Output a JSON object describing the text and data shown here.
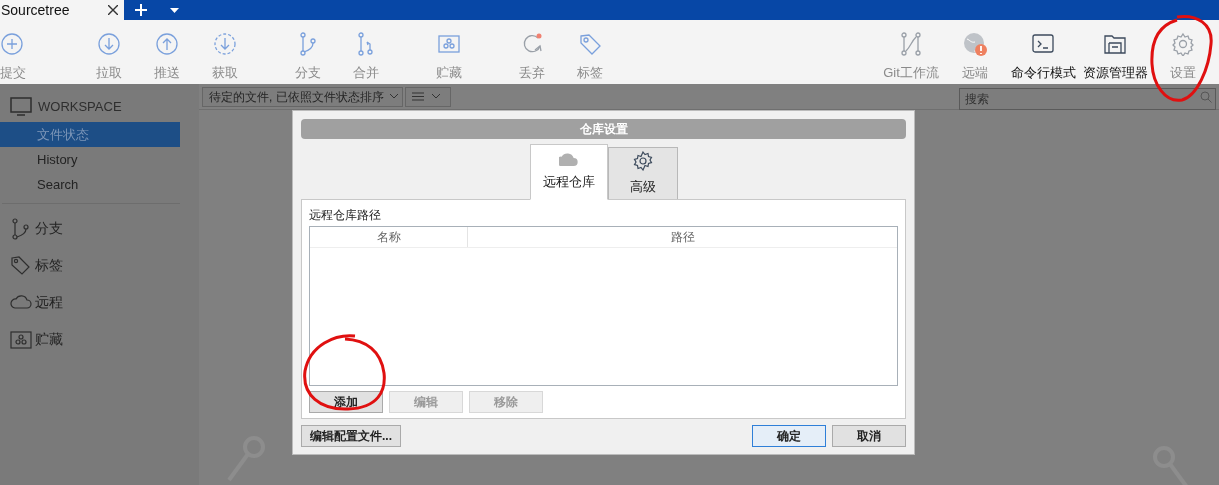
{
  "window": {
    "tabs": [
      {
        "label": "Sourcetree",
        "selected": true
      }
    ]
  },
  "toolbar": {
    "left": [
      {
        "label": "提交",
        "disabled": true
      },
      {
        "label": "拉取",
        "disabled": true
      },
      {
        "label": "推送",
        "disabled": true
      },
      {
        "label": "获取",
        "disabled": true
      },
      {
        "label": "分支",
        "disabled": true
      },
      {
        "label": "合并",
        "disabled": true
      },
      {
        "label": "贮藏",
        "disabled": true
      },
      {
        "label": "丢弃",
        "disabled": true
      },
      {
        "label": "标签",
        "disabled": true
      }
    ],
    "right": [
      {
        "label": "Git工作流",
        "disabled": true
      },
      {
        "label": "远端",
        "disabled": true
      },
      {
        "label": "命令行模式",
        "disabled": false
      },
      {
        "label": "资源管理器",
        "disabled": false
      },
      {
        "label": "设置",
        "disabled": true
      }
    ]
  },
  "sidebar": {
    "workspace": "WORKSPACE",
    "items": [
      {
        "label": "文件状态",
        "selected": true
      },
      {
        "label": "History",
        "selected": false
      },
      {
        "label": "Search",
        "selected": false
      }
    ],
    "sections": [
      "分支",
      "标签",
      "远程",
      "贮藏"
    ]
  },
  "file_filter": "待定的文件, 已依照文件状态排序",
  "search": {
    "placeholder": "搜索"
  },
  "dialog": {
    "title": "仓库设置",
    "tabs": [
      {
        "label": "远程仓库",
        "selected": true
      },
      {
        "label": "高级",
        "selected": false
      }
    ],
    "section_label": "远程仓库路径",
    "columns": [
      "名称",
      "路径"
    ],
    "list_buttons": [
      {
        "label": "添加",
        "disabled": false
      },
      {
        "label": "编辑",
        "disabled": true
      },
      {
        "label": "移除",
        "disabled": true
      }
    ],
    "edit_config": "编辑配置文件...",
    "buttons": [
      {
        "label": "确定",
        "default": true
      },
      {
        "label": "取消",
        "default": false
      }
    ]
  }
}
